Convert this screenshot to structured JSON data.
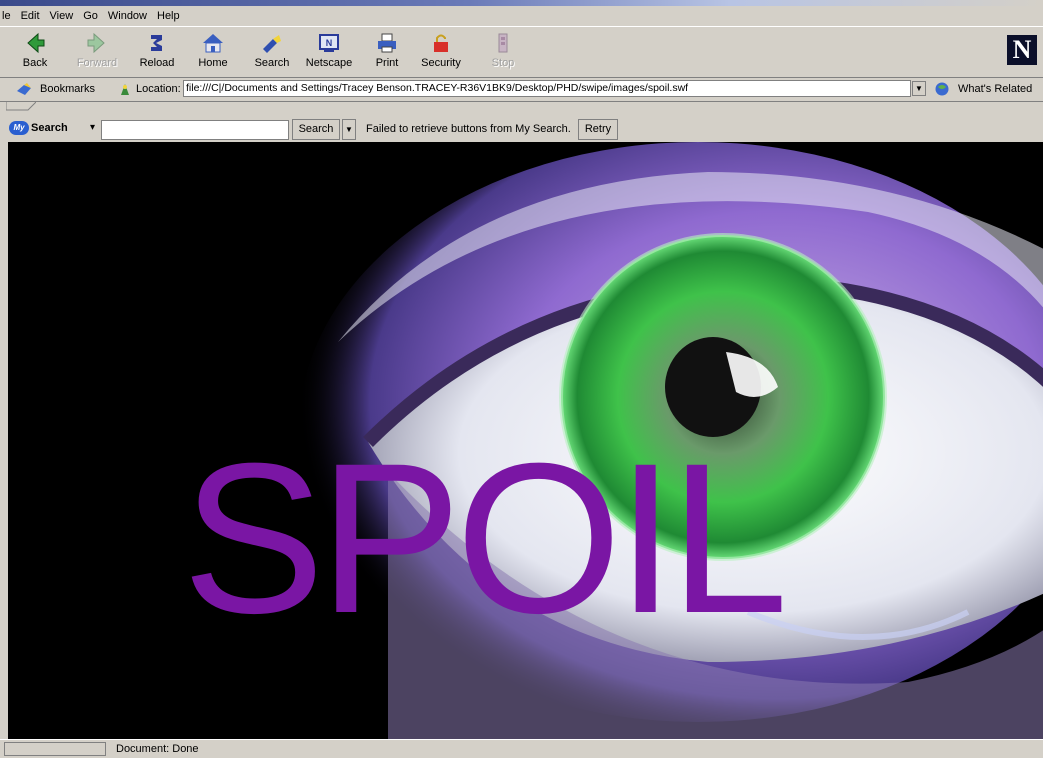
{
  "menu": [
    "le",
    "Edit",
    "View",
    "Go",
    "Window",
    "Help"
  ],
  "toolbar": {
    "back": "Back",
    "forward": "Forward",
    "reload": "Reload",
    "home": "Home",
    "search": "Search",
    "netscape": "Netscape",
    "print": "Print",
    "security": "Security",
    "stop": "Stop"
  },
  "location": {
    "bookmarks": "Bookmarks",
    "label": "Location:",
    "url": "file:///C|/Documents and Settings/Tracey Benson.TRACEY-R36V1BK9/Desktop/PHD/swipe/images/spoil.swf",
    "related": "What's Related"
  },
  "mysearch": {
    "logo": "My",
    "label": "Search",
    "button": "Search",
    "status": "Failed to retrieve buttons from My Search.",
    "retry": "Retry",
    "query": ""
  },
  "content": {
    "overlay_text": "SPOIL"
  },
  "status": {
    "text": "Document: Done"
  },
  "colors": {
    "spoil": "#7a16a4",
    "chrome": "#d4d0c8",
    "iris": "#3fc24a"
  }
}
